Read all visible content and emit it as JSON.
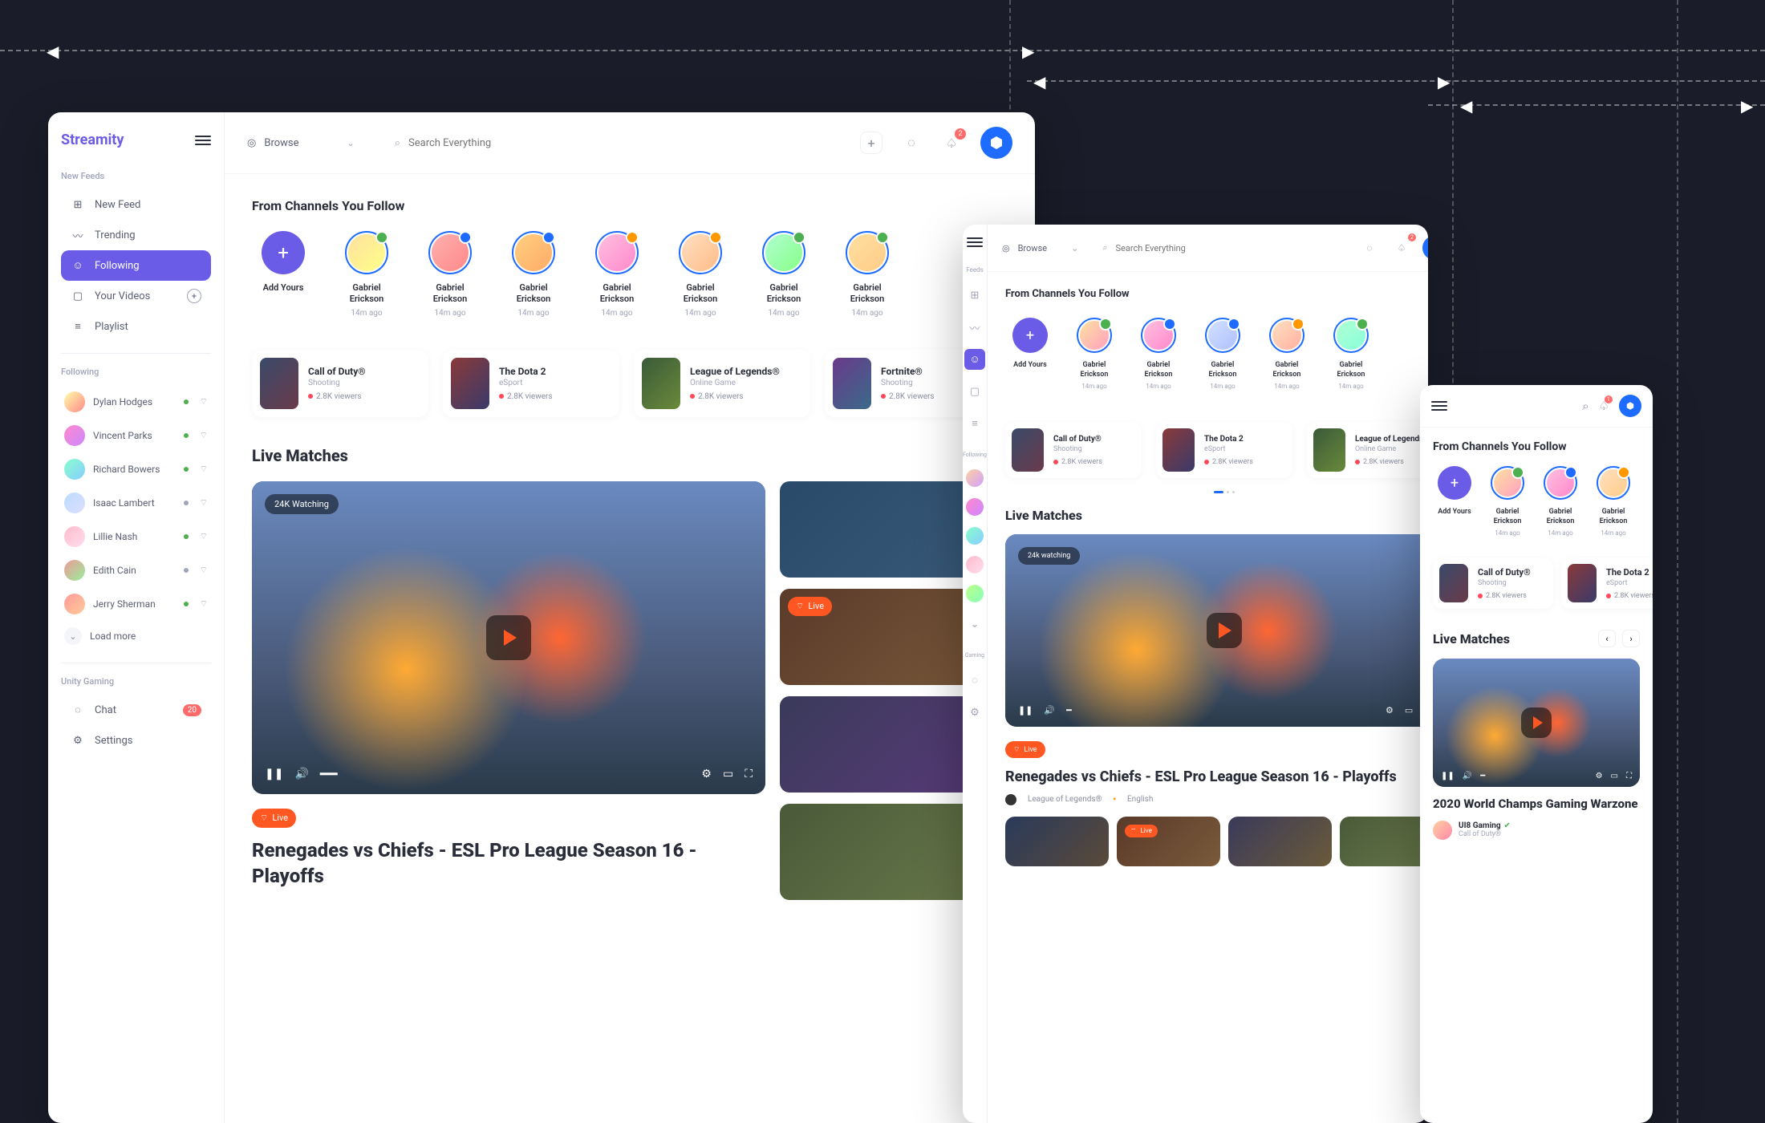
{
  "app": {
    "name": "Streamity"
  },
  "topbar": {
    "browse": "Browse",
    "search_placeholder": "Search Everything",
    "notif_count": "2"
  },
  "sidebar": {
    "section_feeds": "New Feeds",
    "section_following": "Following",
    "section_unity": "Unity Gaming",
    "nav": {
      "new_feed": "New Feed",
      "trending": "Trending",
      "following": "Following",
      "your_videos": "Your Videos",
      "playlist": "Playlist",
      "chat": "Chat",
      "settings": "Settings",
      "load_more": "Load more",
      "chat_badge": "20"
    },
    "users": [
      {
        "name": "Dylan Hodges",
        "dot": "#4caf50"
      },
      {
        "name": "Vincent Parks",
        "dot": "#4caf50"
      },
      {
        "name": "Richard Bowers",
        "dot": "#4caf50"
      },
      {
        "name": "Isaac Lambert",
        "dot": "#a0a4b8"
      },
      {
        "name": "Lillie Nash",
        "dot": "#4caf50"
      },
      {
        "name": "Edith Cain",
        "dot": "#a0a4b8"
      },
      {
        "name": "Jerry Sherman",
        "dot": "#4caf50"
      }
    ]
  },
  "sidebar_mini": {
    "label_feeds": "Feeds",
    "label_following": "Following",
    "label_gaming": "Gaming"
  },
  "channels": {
    "title": "From Channels You Follow",
    "add_label": "Add Yours",
    "item_name": "Gabriel Erickson",
    "item_time": "14m ago"
  },
  "games": [
    {
      "title": "Call of Duty®",
      "sub": "Shooting",
      "viewers": "2.8K viewers"
    },
    {
      "title": "The Dota 2",
      "sub": "eSport",
      "viewers": "2.8K viewers"
    },
    {
      "title": "League of Legends®",
      "sub": "Online Game",
      "viewers": "2.8K viewers"
    },
    {
      "title": "Fortnite®",
      "sub": "Shooting",
      "viewers": "2.8K viewers"
    }
  ],
  "live": {
    "section_title": "Live Matches",
    "watching": "24K Watching",
    "watching_tablet": "24k watching",
    "live_label": "Live",
    "hero_title": "Renegades vs Chiefs - ESL Pro League Season 16 - Playoffs",
    "meta_game": "League of Legends®",
    "meta_lang": "English"
  },
  "mobile": {
    "hero_title": "2020 World Champs Gaming Warzone",
    "author": "UI8 Gaming",
    "author_sub": "Call of Duty®",
    "notif_count": "1"
  }
}
